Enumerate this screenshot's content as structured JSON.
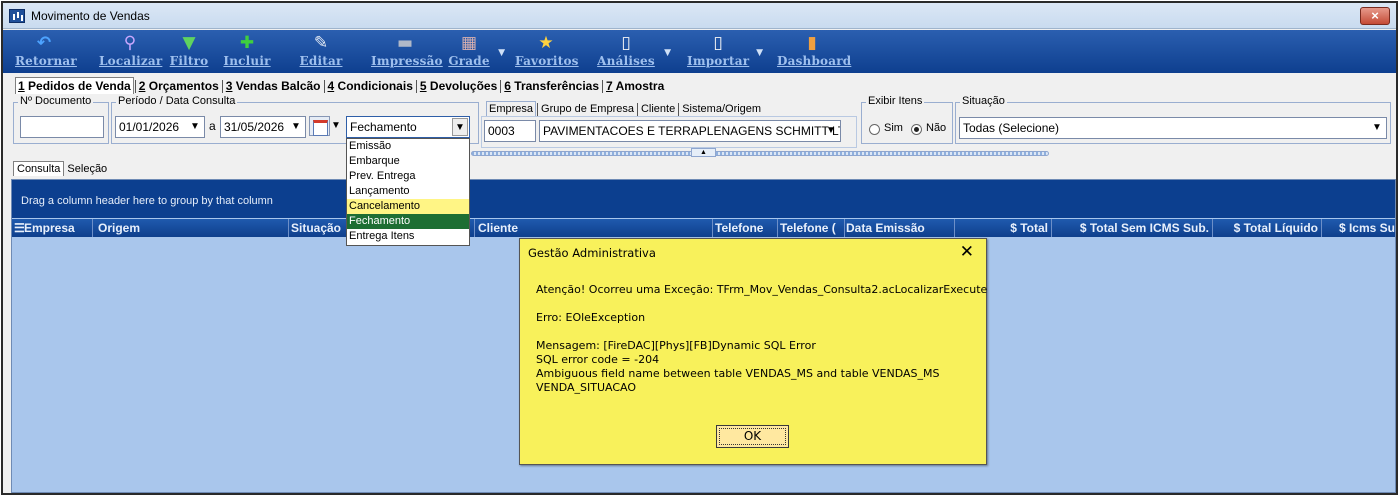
{
  "window": {
    "title": "Movimento de Vendas",
    "close_label": "×"
  },
  "toolbar": [
    {
      "name": "retornar-button",
      "label": "Retornar",
      "icon": "↶",
      "icon_name": "undo-arrow-icon",
      "color": "#4da3ff"
    },
    {
      "name": "localizar-button",
      "label": "Localizar",
      "icon": "⚲",
      "icon_name": "magnifier-icon",
      "color": "#c9a7ff"
    },
    {
      "name": "filtro-button",
      "label": "Filtro",
      "icon": "▼",
      "icon_name": "funnel-icon",
      "color": "#5fd35f"
    },
    {
      "name": "incluir-button",
      "label": "Incluir",
      "icon": "✚",
      "icon_name": "plus-icon",
      "color": "#3fcf3f"
    },
    {
      "name": "editar-button",
      "label": "Editar",
      "icon": "✎",
      "icon_name": "edit-icon",
      "color": "#e6ecf5"
    },
    {
      "name": "impressao-button",
      "label": "Impressão",
      "icon": "▬",
      "icon_name": "printer-icon",
      "color": "#b0b8c8"
    },
    {
      "name": "grade-button",
      "label": "Grade",
      "icon": "▦",
      "icon_name": "grid-icon",
      "color": "#d8b0b0"
    },
    {
      "name": "favoritos-button",
      "label": "Favoritos",
      "icon": "★",
      "icon_name": "star-icon",
      "color": "#ffd23f"
    },
    {
      "name": "analises-button",
      "label": "Análises",
      "icon": "▯",
      "icon_name": "document-icon",
      "color": "#f5f5f5"
    },
    {
      "name": "importar-button",
      "label": "Importar",
      "icon": "▯",
      "icon_name": "import-icon",
      "color": "#f5f5f5"
    },
    {
      "name": "dashboard-button",
      "label": "Dashboard",
      "icon": "▮",
      "icon_name": "bar-chart-icon",
      "color": "#f0a040"
    }
  ],
  "tabs": [
    {
      "key": "1",
      "rest": " Pedidos de Venda"
    },
    {
      "key": "2",
      "rest": " Orçamentos"
    },
    {
      "key": "3",
      "rest": " Vendas Balcão"
    },
    {
      "key": "4",
      "rest": " Condicionais"
    },
    {
      "key": "5",
      "rest": " Devoluções"
    },
    {
      "key": "6",
      "rest": " Transferências"
    },
    {
      "key": "7",
      "rest": " Amostra"
    }
  ],
  "filters": {
    "nro_documento_label": "Nº Documento",
    "nro_documento_value": "",
    "periodo_label": "Período / Data Consulta",
    "date_from": "01/01/2026",
    "date_sep": "a",
    "date_to": "31/05/2026",
    "date_type_selected": "Fechamento",
    "date_type_options": [
      "Emissão",
      "Embarque",
      "Prev. Entrega",
      "Lançamento",
      "Cancelamento",
      "Fechamento",
      "Entrega Itens"
    ],
    "empresa_tabs": [
      "Empresa",
      "Grupo de Empresa",
      "Cliente",
      "Sistema/Origem"
    ],
    "empresa_code": "0003",
    "empresa_name": "PAVIMENTACOES E TERRAPLENAGENS SCHMITT LTI",
    "exibir_itens_label": "Exibir Itens",
    "sim_label": "Sim",
    "nao_label": "Não",
    "situacao_label": "Situação",
    "situacao_value": "Todas (Selecione)"
  },
  "subtabs": [
    "Consulta",
    "Seleção"
  ],
  "grid": {
    "group_hint": "Drag a column header here to group by that column",
    "columns": [
      "Empresa",
      "Origem",
      "Situação",
      "Cliente",
      "Telefone",
      "Telefone (",
      "Data Emissão",
      "$ Total",
      "$ Total Sem ICMS Sub.",
      "$ Total Líquido",
      "$ Icms Su"
    ]
  },
  "dialog": {
    "title": "Gestão Administrativa",
    "close_label": "✕",
    "lines": [
      "Atenção! Ocorreu uma Exceção: TFrm_Mov_Vendas_Consulta2.acLocalizarExecute",
      "",
      "Erro: EOleException",
      "",
      " Mensagem: [FireDAC][Phys][FB]Dynamic SQL Error",
      "SQL error code = -204",
      "Ambiguous field name between table VENDAS_MS and table VENDAS_MS",
      "VENDA_SITUACAO"
    ],
    "ok_label": "OK"
  }
}
